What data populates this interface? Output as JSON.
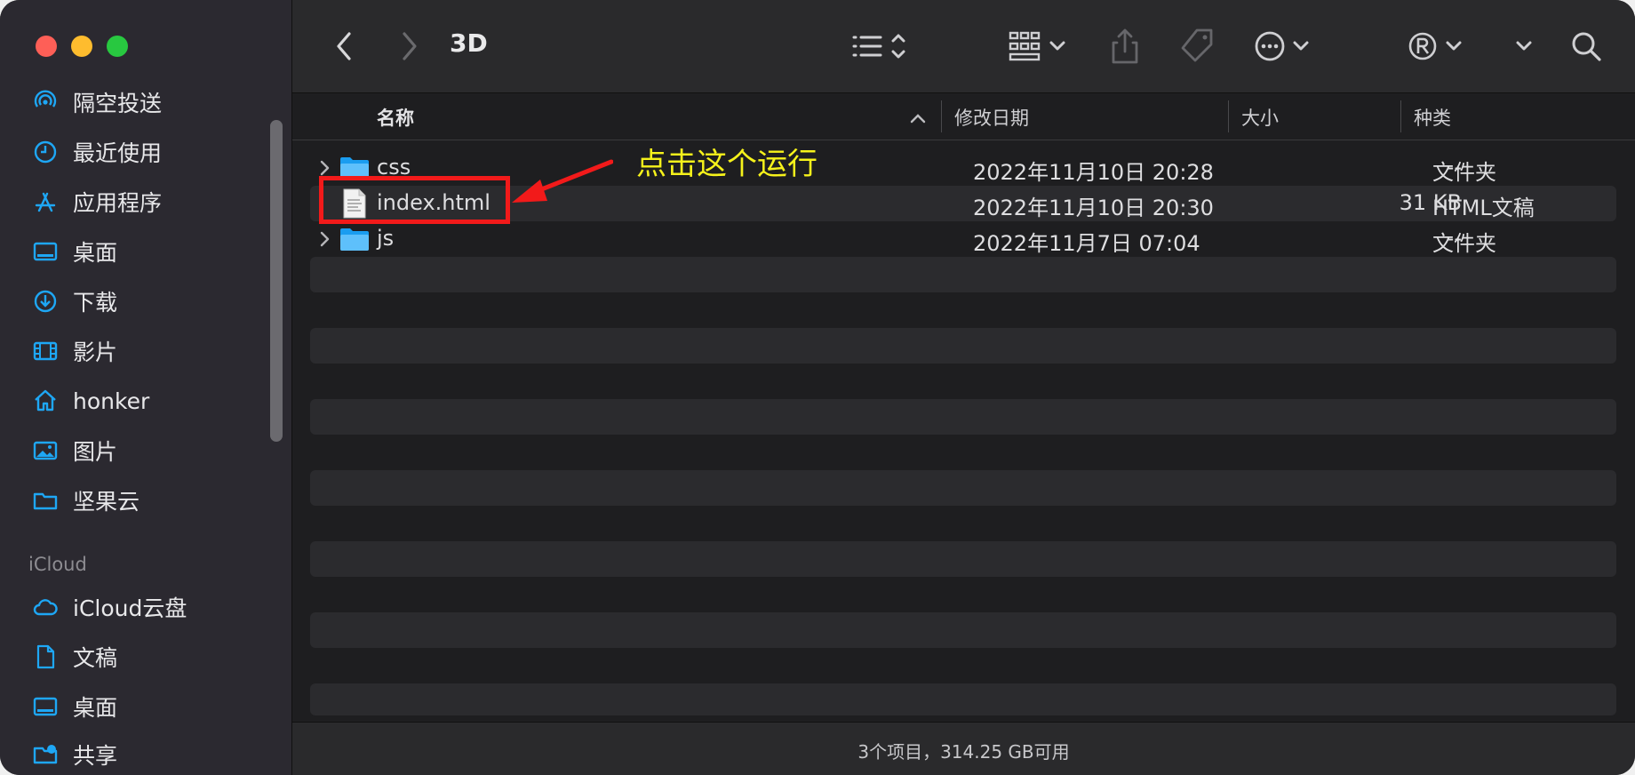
{
  "window": {
    "title": "3D"
  },
  "sidebar": {
    "favorites": [
      {
        "label": "隔空投送",
        "icon": "airdrop-icon"
      },
      {
        "label": "最近使用",
        "icon": "clock-icon"
      },
      {
        "label": "应用程序",
        "icon": "applications-icon"
      },
      {
        "label": "桌面",
        "icon": "desktop-icon"
      },
      {
        "label": "下载",
        "icon": "download-icon"
      },
      {
        "label": "影片",
        "icon": "film-icon"
      },
      {
        "label": "honker",
        "icon": "home-icon"
      },
      {
        "label": "图片",
        "icon": "photo-icon"
      },
      {
        "label": "坚果云",
        "icon": "folder-icon"
      }
    ],
    "icloud_section": "iCloud",
    "icloud": [
      {
        "label": "iCloud云盘",
        "icon": "cloud-icon"
      },
      {
        "label": "文稿",
        "icon": "document-icon"
      },
      {
        "label": "桌面",
        "icon": "desktop-icon"
      },
      {
        "label": "共享",
        "icon": "shared-folder-icon"
      }
    ]
  },
  "columns": {
    "name": "名称",
    "date": "修改日期",
    "size": "大小",
    "kind": "种类"
  },
  "files": [
    {
      "name": "css",
      "date": "2022年11月10日 20:28",
      "size": "--",
      "kind": "文件夹",
      "type": "folder"
    },
    {
      "name": "index.html",
      "date": "2022年11月10日 20:30",
      "size": "31 KB",
      "kind": "HTML文稿",
      "type": "html"
    },
    {
      "name": "js",
      "date": "2022年11月7日 07:04",
      "size": "--",
      "kind": "文件夹",
      "type": "folder"
    }
  ],
  "annotation": {
    "text": "点击这个运行"
  },
  "status": {
    "text": "3个项目，314.25 GB可用"
  },
  "colors": {
    "accent": "#1ea7f5",
    "highlight": "#f21a1a",
    "annotation": "#f6f21b"
  }
}
